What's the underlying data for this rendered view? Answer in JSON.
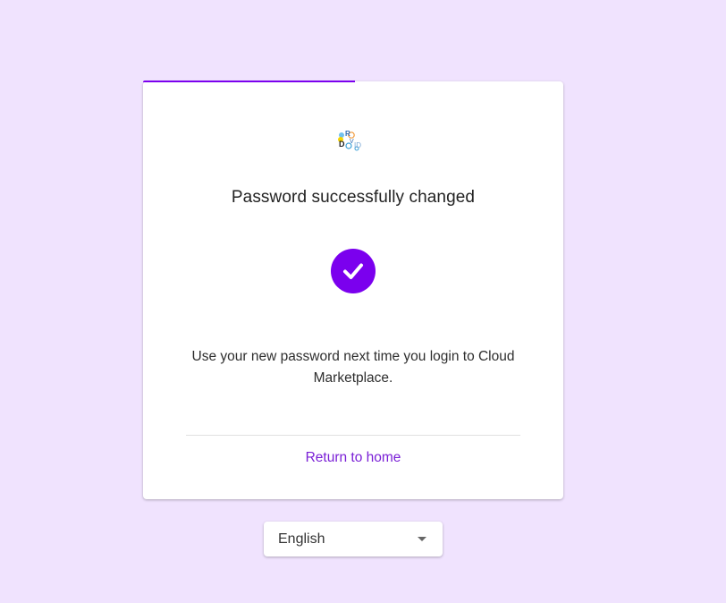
{
  "theme": {
    "background": "#f0e3fe",
    "accent": "#7b00ee",
    "link": "#7a1fd6"
  },
  "card": {
    "logo_icon": "rdvid-logo-icon",
    "title": "Password successfully changed",
    "status_icon": "check-circle-icon",
    "message": "Use your new password next time you login to Cloud Marketplace.",
    "return_link": "Return to home"
  },
  "language": {
    "selected": "English",
    "icon": "caret-down-icon"
  }
}
